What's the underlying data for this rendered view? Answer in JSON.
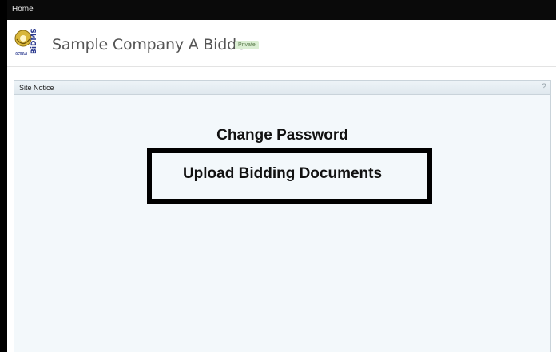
{
  "nav": {
    "home_label": "Home"
  },
  "header": {
    "company_name": "Sample Company A Bidder",
    "badge": "Private",
    "logo_text": "BiDMS"
  },
  "panel": {
    "title": "Site Notice",
    "help": "?",
    "links": {
      "change_password": "Change Password",
      "upload_documents": "Upload Bidding Documents"
    }
  },
  "colors": {
    "topbar": "#0a0a0a",
    "panel_bg": "#f3f8fb",
    "badge_bg": "#dbeed3",
    "badge_text": "#5c7d4e"
  }
}
